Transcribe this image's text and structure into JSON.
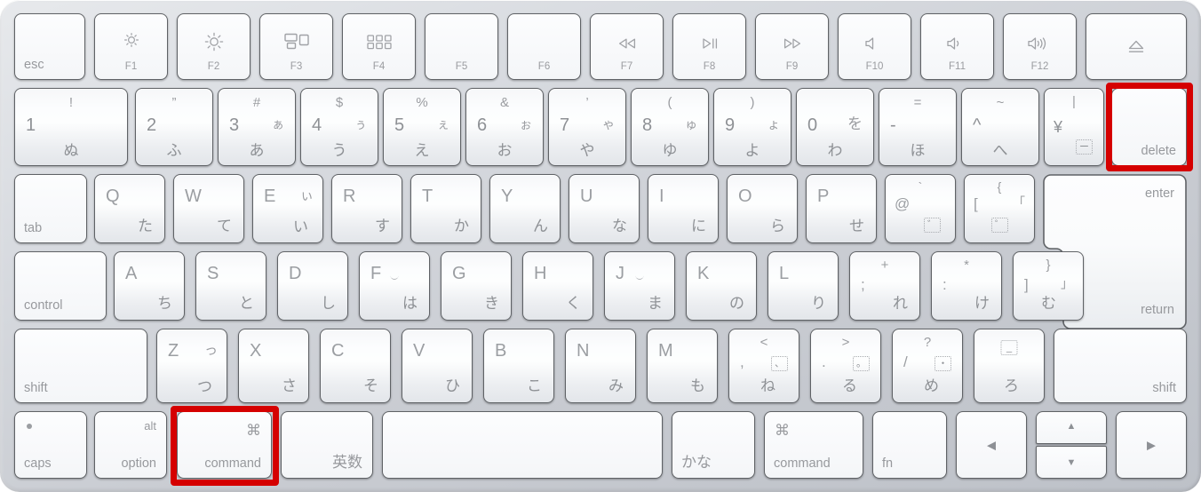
{
  "device": {
    "name": "apple-magic-keyboard-jis",
    "layout": "JIS Japanese",
    "body_color": "#cdd0d6",
    "key_color": "#fafbfc",
    "highlight_color": "#d50000"
  },
  "highlights": [
    {
      "target": "delete",
      "label": "delete-key-highlight"
    },
    {
      "target": "command",
      "label": "left-command-key-highlight"
    }
  ],
  "rows": {
    "function": [
      {
        "name": "esc",
        "label": "esc",
        "label_pos": "bl"
      },
      {
        "name": "f1",
        "fn": "F1",
        "icon": "brightness-down-icon"
      },
      {
        "name": "f2",
        "fn": "F2",
        "icon": "brightness-up-icon"
      },
      {
        "name": "f3",
        "fn": "F3",
        "icon": "mission-control-icon"
      },
      {
        "name": "f4",
        "fn": "F4",
        "icon": "launchpad-icon"
      },
      {
        "name": "f5",
        "fn": "F5",
        "icon": "none"
      },
      {
        "name": "f6",
        "fn": "F6",
        "icon": "none"
      },
      {
        "name": "f7",
        "fn": "F7",
        "icon": "rewind-icon"
      },
      {
        "name": "f8",
        "fn": "F8",
        "icon": "play-pause-icon"
      },
      {
        "name": "f9",
        "fn": "F9",
        "icon": "fast-forward-icon"
      },
      {
        "name": "f10",
        "fn": "F10",
        "icon": "volume-mute-icon"
      },
      {
        "name": "f11",
        "fn": "F11",
        "icon": "volume-down-icon"
      },
      {
        "name": "f12",
        "fn": "F12",
        "icon": "volume-up-icon"
      },
      {
        "name": "eject",
        "fn": "",
        "icon": "eject-icon"
      }
    ],
    "number": [
      {
        "name": "1",
        "top": "!",
        "main": "1",
        "kana_tr": "",
        "kana_b": "ぬ"
      },
      {
        "name": "2",
        "top": "”",
        "main": "2",
        "kana_tr": "",
        "kana_b": "ふ"
      },
      {
        "name": "3",
        "top": "#",
        "main": "3",
        "kana_tr": "ぁ",
        "kana_b": "あ"
      },
      {
        "name": "4",
        "top": "$",
        "main": "4",
        "kana_tr": "ぅ",
        "kana_b": "う"
      },
      {
        "name": "5",
        "top": "%",
        "main": "5",
        "kana_tr": "ぇ",
        "kana_b": "え"
      },
      {
        "name": "6",
        "top": "&",
        "main": "6",
        "kana_tr": "ぉ",
        "kana_b": "お"
      },
      {
        "name": "7",
        "top": "’",
        "main": "7",
        "kana_tr": "ゃ",
        "kana_b": "や"
      },
      {
        "name": "8",
        "top": "(",
        "main": "8",
        "kana_tr": "ゅ",
        "kana_b": "ゆ"
      },
      {
        "name": "9",
        "top": ")",
        "main": "9",
        "kana_tr": "ょ",
        "kana_b": "よ"
      },
      {
        "name": "0",
        "top": "",
        "main": "0",
        "kana_tr": "を",
        "kana_b": "わ"
      },
      {
        "name": "minus",
        "top": "=",
        "main": "-",
        "kana_tr": "",
        "kana_b": "ほ"
      },
      {
        "name": "caret",
        "top": "~",
        "main": "^",
        "kana_tr": "",
        "kana_b": "へ"
      },
      {
        "name": "yen",
        "top": "|",
        "main": "¥",
        "kana_tr": "",
        "kana_b": "dotted-dash"
      },
      {
        "name": "delete",
        "label": "delete",
        "label_pos": "br"
      }
    ],
    "qwerty": [
      {
        "name": "tab",
        "label": "tab",
        "label_pos": "bl"
      },
      {
        "name": "q",
        "letter": "Q",
        "kana": "た"
      },
      {
        "name": "w",
        "letter": "W",
        "kana": "て"
      },
      {
        "name": "e",
        "letter": "E",
        "kana": "い",
        "kana_small": "ぃ"
      },
      {
        "name": "r",
        "letter": "R",
        "kana": "す"
      },
      {
        "name": "t",
        "letter": "T",
        "kana": "か"
      },
      {
        "name": "y",
        "letter": "Y",
        "kana": "ん"
      },
      {
        "name": "u",
        "letter": "U",
        "kana": "な"
      },
      {
        "name": "i",
        "letter": "I",
        "kana": "に"
      },
      {
        "name": "o",
        "letter": "O",
        "kana": "ら"
      },
      {
        "name": "p",
        "letter": "P",
        "kana": "せ"
      },
      {
        "name": "at",
        "top": "`",
        "letter": "@",
        "kana": "dotted-ring"
      },
      {
        "name": "bracket-left",
        "top": "{",
        "letter": "[",
        "kana_tr": "「",
        "kana": "dotted-ring-deg"
      },
      {
        "name": "enter",
        "label": "enter",
        "label_pos": "tr"
      }
    ],
    "home": [
      {
        "name": "control",
        "label": "control",
        "label_pos": "bl"
      },
      {
        "name": "a",
        "letter": "A",
        "kana": "ち"
      },
      {
        "name": "s",
        "letter": "S",
        "kana": "と"
      },
      {
        "name": "d",
        "letter": "D",
        "kana": "し"
      },
      {
        "name": "f",
        "letter": "F",
        "kana": "は",
        "bump": true
      },
      {
        "name": "g",
        "letter": "G",
        "kana": "き"
      },
      {
        "name": "h",
        "letter": "H",
        "kana": "く"
      },
      {
        "name": "j",
        "letter": "J",
        "kana": "ま",
        "bump": true
      },
      {
        "name": "k",
        "letter": "K",
        "kana": "の"
      },
      {
        "name": "l",
        "letter": "L",
        "kana": "り"
      },
      {
        "name": "semicolon",
        "top": "+",
        "letter": ";",
        "kana": "れ"
      },
      {
        "name": "colon",
        "top": "*",
        "letter": ":",
        "kana": "け"
      },
      {
        "name": "bracket-right",
        "top": "}",
        "letter": "]",
        "kana_tr": "」",
        "kana": "む"
      },
      {
        "name": "return",
        "label": "return",
        "label_pos": "br"
      }
    ],
    "shift": [
      {
        "name": "shift-left",
        "label": "shift",
        "label_pos": "bl"
      },
      {
        "name": "z",
        "letter": "Z",
        "kana": "つ",
        "kana_small": "っ"
      },
      {
        "name": "x",
        "letter": "X",
        "kana": "さ"
      },
      {
        "name": "c",
        "letter": "C",
        "kana": "そ"
      },
      {
        "name": "v",
        "letter": "V",
        "kana": "ひ"
      },
      {
        "name": "b",
        "letter": "B",
        "kana": "こ"
      },
      {
        "name": "n",
        "letter": "N",
        "kana": "み"
      },
      {
        "name": "m",
        "letter": "M",
        "kana": "も"
      },
      {
        "name": "comma",
        "top": "<",
        "letter": ",",
        "kana": "ね",
        "kana_box": "dotted-comma"
      },
      {
        "name": "period",
        "top": ">",
        "letter": ".",
        "kana": "る",
        "kana_box": "dotted-ring"
      },
      {
        "name": "slash",
        "top": "?",
        "letter": "/",
        "kana": "め",
        "kana_box": "dotted-dot"
      },
      {
        "name": "backslash",
        "letter": "",
        "kana": "ろ",
        "kana_box": "dotted-underscore"
      },
      {
        "name": "shift-right",
        "label": "shift",
        "label_pos": "br"
      }
    ],
    "bottom": [
      {
        "name": "caps",
        "label": "caps",
        "label_pos": "bl",
        "led": true
      },
      {
        "name": "option",
        "label": "option",
        "label_pos": "br",
        "alt": "alt"
      },
      {
        "name": "command",
        "label": "command",
        "label_pos": "br",
        "glyph": "⌘"
      },
      {
        "name": "eisu",
        "label": "英数",
        "label_pos": "br"
      },
      {
        "name": "space",
        "label": "",
        "label_pos": "cc"
      },
      {
        "name": "kana",
        "label": "かな",
        "label_pos": "bl"
      },
      {
        "name": "command-right",
        "label": "command",
        "label_pos": "bl",
        "glyph": "⌘"
      },
      {
        "name": "fn",
        "label": "fn",
        "label_pos": "bl"
      },
      {
        "name": "arrow-left",
        "glyph": "◀"
      },
      {
        "name": "arrow-up",
        "glyph": "▲"
      },
      {
        "name": "arrow-down",
        "glyph": "▼"
      },
      {
        "name": "arrow-right",
        "glyph": "▶"
      }
    ]
  }
}
